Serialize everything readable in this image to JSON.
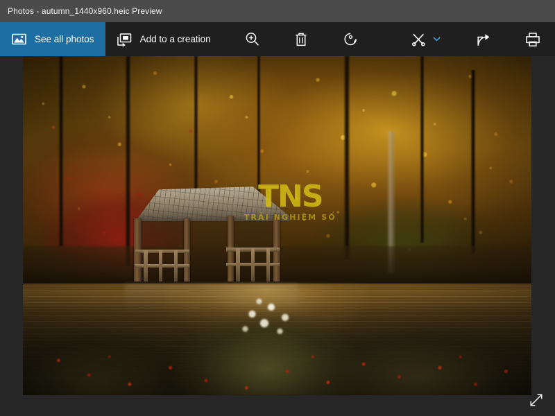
{
  "window": {
    "title": "Photos - autumn_1440x960.heic Preview"
  },
  "toolbar": {
    "see_all_photos": {
      "label": "See all photos",
      "icon": "photos-icon",
      "accent_color": "#1d6ea3"
    },
    "add_to_creation": {
      "label": "Add to a creation",
      "icon": "add-to-creation-icon"
    },
    "zoom": {
      "icon": "zoom-in-icon"
    },
    "delete": {
      "icon": "trash-icon"
    },
    "rotate": {
      "icon": "rotate-icon"
    },
    "edit_create": {
      "icon": "edit-create-icon",
      "chevron": "chevron-down-icon"
    },
    "share": {
      "icon": "share-icon"
    },
    "print": {
      "icon": "print-icon"
    },
    "more": {
      "icon": "more-icon",
      "glyph": "• • •"
    }
  },
  "viewer": {
    "fullscreen": {
      "icon": "fullscreen-icon"
    },
    "photo": {
      "name": "autumn-landscape-photo",
      "alt": "Autumn forest with wooden pavilion beside a pond",
      "watermark": {
        "main": "TNS",
        "sub": "TRẢI NGHIỆM SỐ",
        "color": "#d0ba16"
      }
    }
  },
  "colors": {
    "titlebar": "#4b4b4b",
    "toolbar": "#1f1f1f",
    "page_background": "#262626",
    "accent": "#1d6ea3",
    "chevron": "#3f9fd0"
  }
}
